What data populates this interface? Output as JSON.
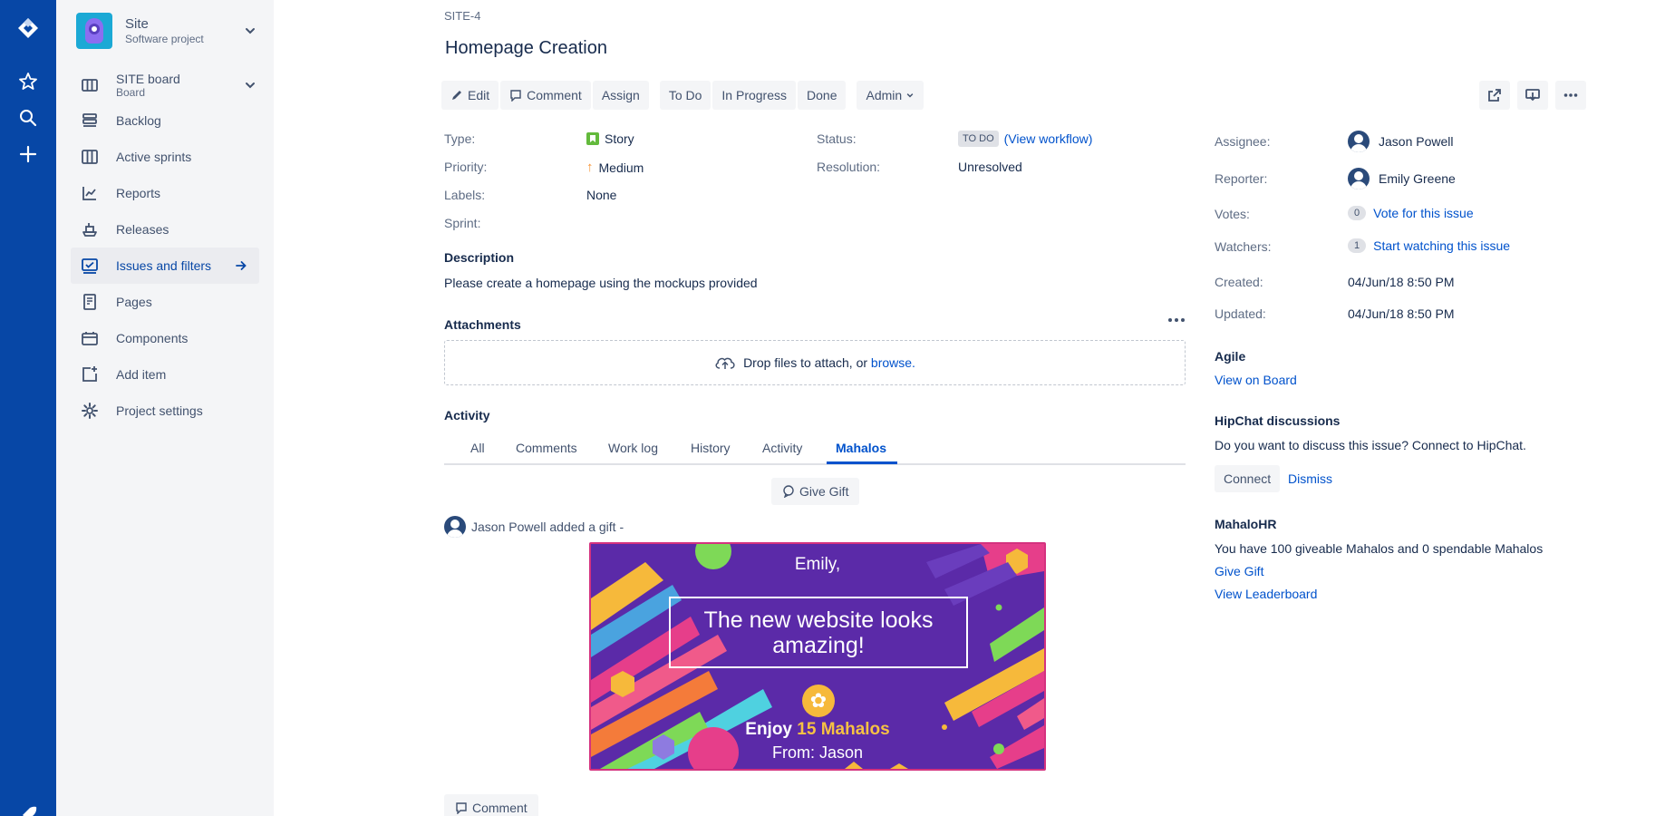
{
  "global_nav": {
    "items": [
      {
        "icon": "jira-logo-icon"
      },
      {
        "icon": "star-icon"
      },
      {
        "icon": "search-icon"
      },
      {
        "icon": "plus-icon"
      }
    ]
  },
  "project": {
    "name": "Site",
    "type": "Software project",
    "board_name": "SITE board",
    "board_type": "Board"
  },
  "sidebar": {
    "items": [
      {
        "label": "Backlog",
        "icon": "backlog-icon",
        "active": false
      },
      {
        "label": "Active sprints",
        "icon": "sprints-icon",
        "active": false
      },
      {
        "label": "Reports",
        "icon": "reports-icon",
        "active": false
      },
      {
        "label": "Releases",
        "icon": "releases-icon",
        "active": false
      },
      {
        "label": "Issues and filters",
        "icon": "issues-icon",
        "active": true
      },
      {
        "label": "Pages",
        "icon": "pages-icon",
        "active": false
      },
      {
        "label": "Components",
        "icon": "components-icon",
        "active": false
      },
      {
        "label": "Add item",
        "icon": "add-item-icon",
        "active": false
      },
      {
        "label": "Project settings",
        "icon": "gear-icon",
        "active": false
      }
    ]
  },
  "issue": {
    "key": "SITE-4",
    "title": "Homepage Creation"
  },
  "toolbar": {
    "edit": "Edit",
    "comment": "Comment",
    "assign": "Assign",
    "todo": "To Do",
    "in_progress": "In Progress",
    "done": "Done",
    "admin": "Admin"
  },
  "details": {
    "type_label": "Type:",
    "type_value": "Story",
    "priority_label": "Priority:",
    "priority_value": "Medium",
    "labels_label": "Labels:",
    "labels_value": "None",
    "sprint_label": "Sprint:",
    "status_label": "Status:",
    "status_value": "TO DO",
    "status_link": "(View workflow)",
    "resolution_label": "Resolution:",
    "resolution_value": "Unresolved"
  },
  "description": {
    "heading": "Description",
    "text": "Please create a homepage using the mockups provided"
  },
  "attachments": {
    "heading": "Attachments",
    "drop_text": "Drop files to attach, or ",
    "browse": "browse."
  },
  "activity": {
    "heading": "Activity",
    "tabs": [
      "All",
      "Comments",
      "Work log",
      "History",
      "Activity",
      "Mahalos"
    ],
    "active_tab": "Mahalos",
    "give_gift": "Give Gift",
    "gift_line": "Jason Powell added a gift -",
    "card": {
      "to": "Emily,",
      "message": "The new website looks amazing!",
      "enjoy": "Enjoy ",
      "amount": "15 Mahalos",
      "from": "From: Jason"
    },
    "comment_button": "Comment"
  },
  "people": {
    "assignee_label": "Assignee:",
    "assignee": "Jason Powell",
    "reporter_label": "Reporter:",
    "reporter": "Emily Greene",
    "votes_label": "Votes:",
    "votes_count": "0",
    "votes_link": "Vote for this issue",
    "watchers_label": "Watchers:",
    "watchers_count": "1",
    "watchers_link": "Start watching this issue"
  },
  "dates": {
    "created_label": "Created:",
    "created": "04/Jun/18 8:50 PM",
    "updated_label": "Updated:",
    "updated": "04/Jun/18 8:50 PM"
  },
  "agile": {
    "heading": "Agile",
    "link": "View on Board"
  },
  "hipchat": {
    "heading": "HipChat discussions",
    "text": "Do you want to discuss this issue? Connect to HipChat.",
    "connect": "Connect",
    "dismiss": "Dismiss"
  },
  "mahalohr": {
    "heading": "MahaloHR",
    "text": "You have 100 giveable Mahalos and 0 spendable Mahalos",
    "give_gift": "Give Gift",
    "leaderboard": "View Leaderboard"
  },
  "colors": {
    "global_nav": "#0747a6",
    "sidebar": "#f4f5f7",
    "link": "#0052cc",
    "card_bg": "#5b2aa8",
    "card_border": "#d4327f"
  }
}
